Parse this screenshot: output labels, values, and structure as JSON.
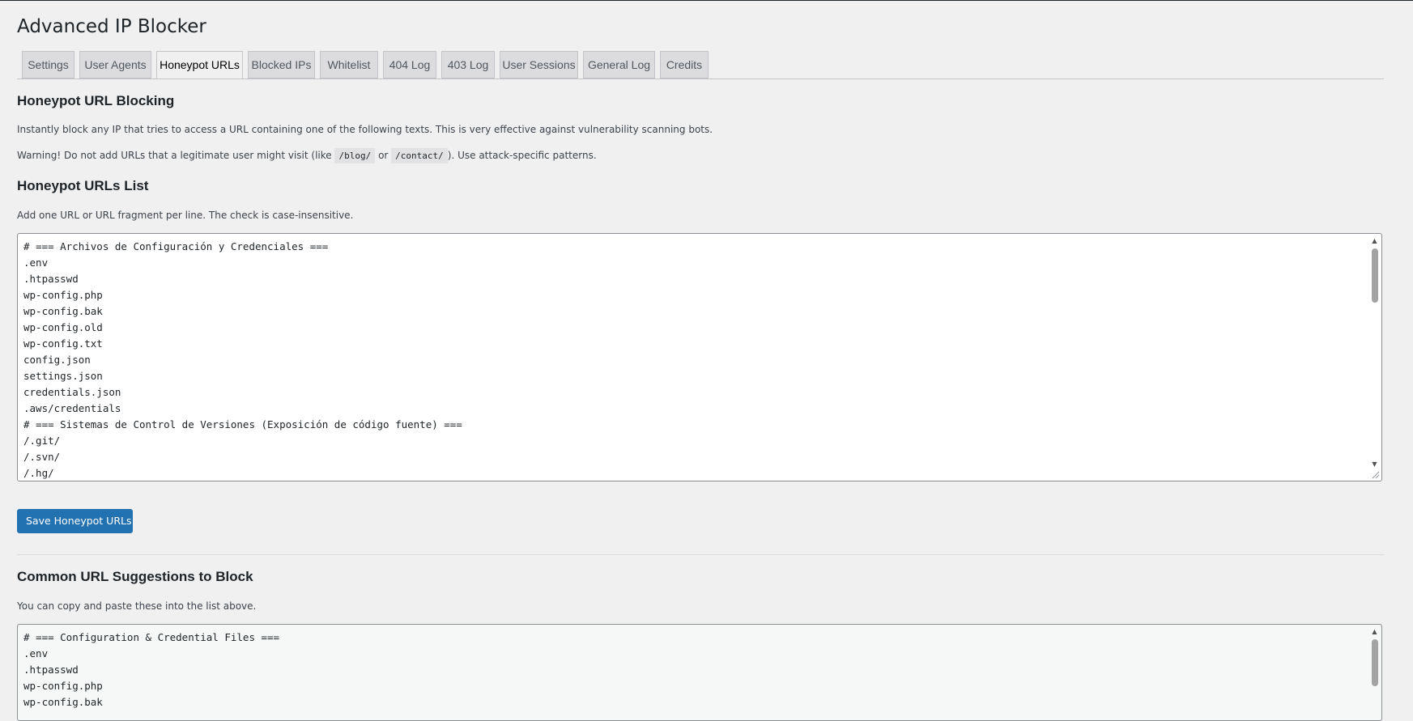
{
  "page": {
    "title": "Advanced IP Blocker"
  },
  "tabs": [
    {
      "label": "Settings",
      "active": false
    },
    {
      "label": "User Agents",
      "active": false
    },
    {
      "label": "Honeypot URLs",
      "active": true
    },
    {
      "label": "Blocked IPs",
      "active": false
    },
    {
      "label": "Whitelist",
      "active": false
    },
    {
      "label": "404 Log",
      "active": false
    },
    {
      "label": "403 Log",
      "active": false
    },
    {
      "label": "User Sessions",
      "active": false
    },
    {
      "label": "General Log",
      "active": false
    },
    {
      "label": "Credits",
      "active": false
    }
  ],
  "blocking": {
    "heading": "Honeypot URL Blocking",
    "description": "Instantly block any IP that tries to access a URL containing one of the following texts. This is very effective against vulnerability scanning bots.",
    "warning_prefix": "Warning! Do not add URLs that a legitimate user might visit (like",
    "code_1": "/blog/",
    "warning_or": "or",
    "code_2": "/contact/",
    "warning_suffix": "). Use attack-specific patterns."
  },
  "list": {
    "heading": "Honeypot URLs List",
    "description": "Add one URL or URL fragment per line. The check is case-insensitive.",
    "lines": [
      "# === Archivos de Configuración y Credenciales ===",
      ".env",
      ".htpasswd",
      "wp-config.php",
      "wp-config.bak",
      "wp-config.old",
      "wp-config.txt",
      "config.json",
      "settings.json",
      "credentials.json",
      ".aws/credentials",
      "# === Sistemas de Control de Versiones (Exposición de código fuente) ===",
      "/.git/",
      "/.svn/",
      "/.hg/"
    ],
    "save_label": "Save Honeypot URLs"
  },
  "suggestions": {
    "heading": "Common URL Suggestions to Block",
    "description": "You can copy and paste these into the list above.",
    "lines": [
      "# === Configuration & Credential Files ===",
      ".env",
      ".htpasswd",
      "wp-config.php",
      "wp-config.bak"
    ]
  },
  "icons": {
    "scroll_up": "scroll-up-arrow-icon",
    "scroll_down": "scroll-down-arrow-icon",
    "resize": "resize-grip-icon"
  },
  "colors": {
    "primary_button": "#2271b1",
    "background": "#f0f0f1",
    "active_tab": "#f0f0f1",
    "inactive_tab": "#dcdcde"
  }
}
